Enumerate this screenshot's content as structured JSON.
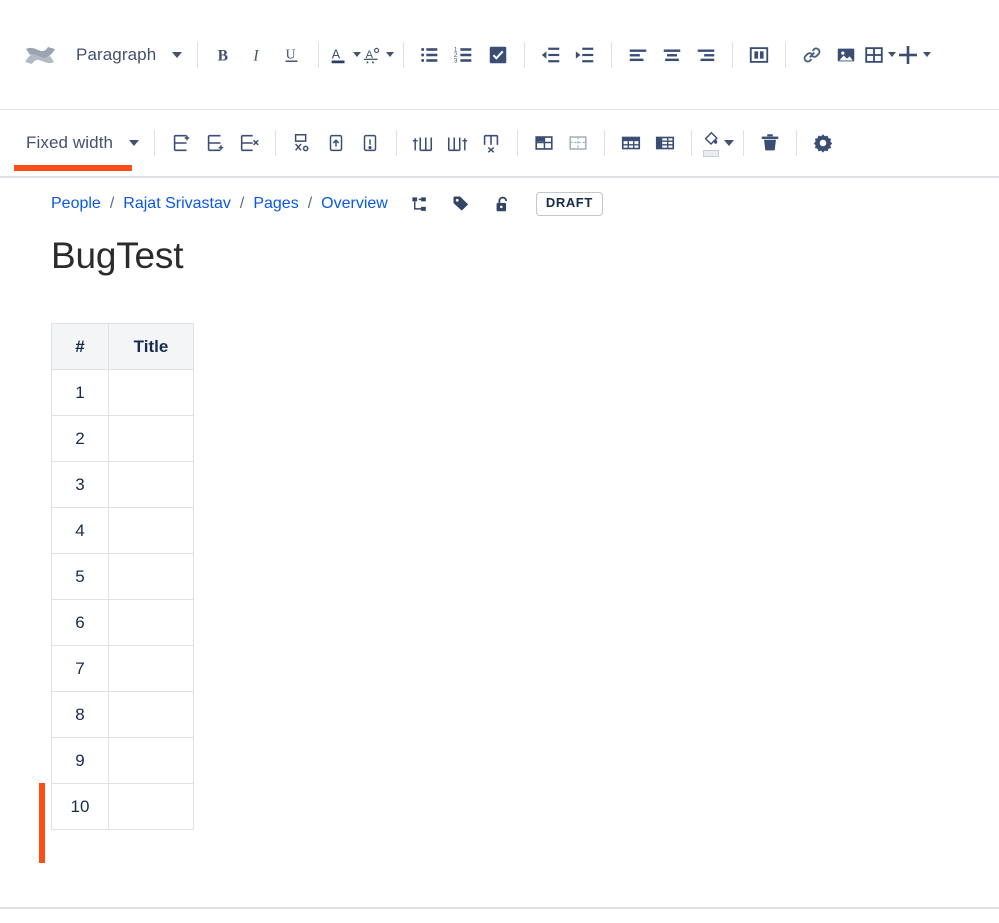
{
  "app": {
    "logo_icon": "confluence-logo"
  },
  "main_toolbar": {
    "block_type": {
      "label": "Paragraph",
      "icon": "chevron-down-icon"
    },
    "groups": [
      {
        "name": "text-style",
        "items": [
          {
            "name": "bold-button",
            "icon": "bold-icon",
            "label": "B"
          },
          {
            "name": "italic-button",
            "icon": "italic-icon",
            "label": "I"
          },
          {
            "name": "underline-button",
            "icon": "underline-icon",
            "label": "U"
          }
        ]
      },
      {
        "name": "color",
        "items": [
          {
            "name": "text-color-button",
            "icon": "text-color-icon"
          },
          {
            "name": "more-text-styles-button",
            "icon": "clear-formatting-icon"
          }
        ]
      },
      {
        "name": "lists",
        "items": [
          {
            "name": "bullet-list-button",
            "icon": "bullet-list-icon"
          },
          {
            "name": "numbered-list-button",
            "icon": "numbered-list-icon"
          },
          {
            "name": "task-list-button",
            "icon": "task-list-icon"
          }
        ]
      },
      {
        "name": "indent",
        "items": [
          {
            "name": "outdent-button",
            "icon": "outdent-icon"
          },
          {
            "name": "indent-button",
            "icon": "indent-icon"
          }
        ]
      },
      {
        "name": "align",
        "items": [
          {
            "name": "align-left-button",
            "icon": "align-left-icon"
          },
          {
            "name": "align-center-button",
            "icon": "align-center-icon"
          },
          {
            "name": "align-right-button",
            "icon": "align-right-icon"
          }
        ]
      },
      {
        "name": "insert",
        "items": [
          {
            "name": "page-layout-button",
            "icon": "page-layout-icon"
          },
          {
            "name": "link-button",
            "icon": "link-icon"
          },
          {
            "name": "image-button",
            "icon": "image-icon"
          },
          {
            "name": "insert-table-button",
            "icon": "table-icon"
          },
          {
            "name": "insert-more-button",
            "icon": "plus-icon"
          }
        ]
      }
    ]
  },
  "table_toolbar": {
    "width_mode": {
      "label": "Fixed width",
      "icon": "chevron-down-icon",
      "highlight_color": "#ff4d18"
    },
    "items": [
      {
        "name": "insert-row-above-button",
        "icon": "insert-row-above-icon"
      },
      {
        "name": "insert-row-below-button",
        "icon": "insert-row-below-icon"
      },
      {
        "name": "delete-row-button",
        "icon": "delete-row-icon"
      },
      {
        "name": "cut-row-button",
        "icon": "cut-row-icon"
      },
      {
        "name": "copy-row-button",
        "icon": "copy-row-icon"
      },
      {
        "name": "paste-row-button",
        "icon": "paste-row-icon"
      },
      {
        "name": "insert-column-left-button",
        "icon": "insert-column-left-icon"
      },
      {
        "name": "insert-column-right-button",
        "icon": "insert-column-right-icon"
      },
      {
        "name": "delete-column-button",
        "icon": "delete-column-icon"
      },
      {
        "name": "merge-cells-button",
        "icon": "merge-cells-icon"
      },
      {
        "name": "split-cell-button",
        "icon": "split-cell-icon"
      },
      {
        "name": "header-row-button",
        "icon": "header-row-icon"
      },
      {
        "name": "header-column-button",
        "icon": "header-column-icon"
      },
      {
        "name": "cell-background-button",
        "icon": "paint-bucket-icon"
      },
      {
        "name": "delete-table-button",
        "icon": "trash-icon"
      },
      {
        "name": "table-settings-button",
        "icon": "gear-icon"
      }
    ]
  },
  "breadcrumb": {
    "items": [
      {
        "label": "People"
      },
      {
        "label": "Rajat Srivastav"
      },
      {
        "label": "Pages"
      },
      {
        "label": "Overview"
      }
    ],
    "separator": "/",
    "icons": [
      {
        "name": "page-tree-icon"
      },
      {
        "name": "label-tag-icon"
      },
      {
        "name": "unlock-icon"
      }
    ],
    "status_badge": "DRAFT"
  },
  "page": {
    "title": "BugTest"
  },
  "table": {
    "headers": [
      "#",
      "Title"
    ],
    "rows": [
      {
        "num": "1",
        "title": ""
      },
      {
        "num": "2",
        "title": ""
      },
      {
        "num": "3",
        "title": ""
      },
      {
        "num": "4",
        "title": ""
      },
      {
        "num": "5",
        "title": ""
      },
      {
        "num": "6",
        "title": ""
      },
      {
        "num": "7",
        "title": ""
      },
      {
        "num": "8",
        "title": ""
      },
      {
        "num": "9",
        "title": ""
      },
      {
        "num": "10",
        "title": ""
      }
    ],
    "active_row_index": 9,
    "active_row_marker_color": "#ff4d18"
  }
}
